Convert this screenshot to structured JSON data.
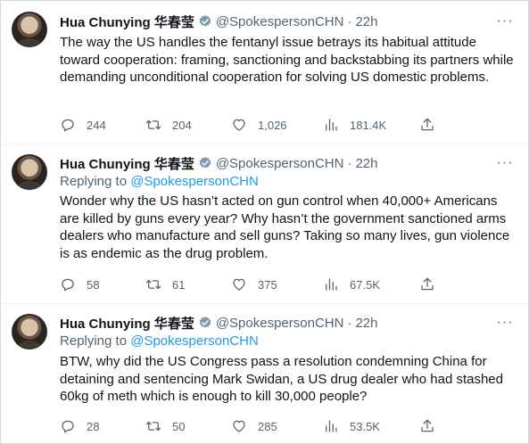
{
  "colors": {
    "accent": "#1d9bf0",
    "secondary_text": "#536471",
    "primary_text": "#0f1419",
    "verified_badge": "#829aab"
  },
  "tweets": [
    {
      "name": "Hua Chunying 华春莹",
      "handle": "@SpokespersonCHN",
      "dot": "·",
      "time": "22h",
      "more": "···",
      "text": "The way the US handles the fentanyl issue betrays its habitual attitude toward cooperation: framing, sanctioning and backstabbing its partners while demanding unconditional cooperation for solving US domestic problems.",
      "replies": "244",
      "retweets": "204",
      "likes": "1,026",
      "views": "181.4K"
    },
    {
      "name": "Hua Chunying 华春莹",
      "handle": "@SpokespersonCHN",
      "dot": "·",
      "time": "22h",
      "more": "···",
      "replying_prefix": "Replying to",
      "replying_handle": "@SpokespersonCHN",
      "text": "Wonder why the US hasn’t acted on gun control when 40,000+ Americans are killed by guns every year? Why hasn’t the government sanctioned arms dealers who manufacture and sell guns? Taking so many lives, gun violence is as endemic as the drug problem.",
      "replies": "58",
      "retweets": "61",
      "likes": "375",
      "views": "67.5K"
    },
    {
      "name": "Hua Chunying 华春莹",
      "handle": "@SpokespersonCHN",
      "dot": "·",
      "time": "22h",
      "more": "···",
      "replying_prefix": "Replying to",
      "replying_handle": "@SpokespersonCHN",
      "text": "BTW, why did the US Congress pass a resolution condemning China for detaining and sentencing Mark Swidan, a US drug dealer who had stashed 60kg of meth which is enough to kill 30,000 people?",
      "replies": "28",
      "retweets": "50",
      "likes": "285",
      "views": "53.5K"
    }
  ]
}
